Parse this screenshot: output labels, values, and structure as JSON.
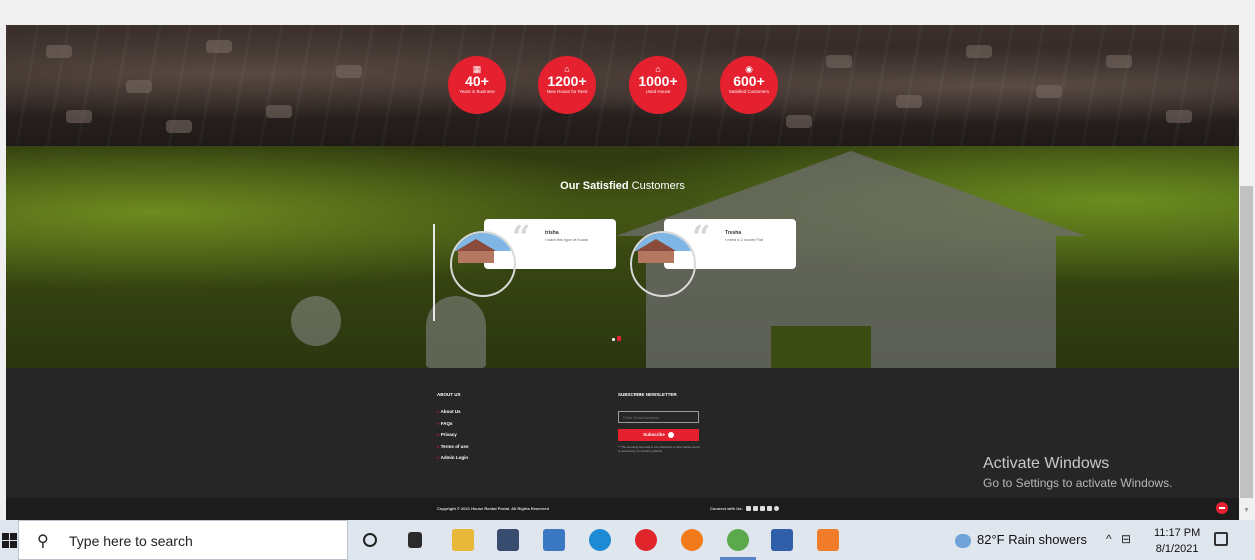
{
  "stats": [
    {
      "number": "40+",
      "label": "Years in Business",
      "icon": "calendar-icon"
    },
    {
      "number": "1200+",
      "label": "New House for Rent",
      "icon": "home-icon"
    },
    {
      "number": "1000+",
      "label": "Used House",
      "icon": "home-icon"
    },
    {
      "number": "600+",
      "label": "Satisfied Customers",
      "icon": "user-circle-icon"
    }
  ],
  "testimonials": {
    "title_bold": "Our Satisfied",
    "title_rest": "Customers",
    "items": [
      {
        "name": "trisha",
        "text": "I want this type of house"
      },
      {
        "name": "Tresha",
        "text": "I need a 2 rooom Flat"
      }
    ]
  },
  "footer": {
    "about_title": "ABOUT US",
    "links": [
      "About Us",
      "FAQs",
      "Privacy",
      "Terms of use",
      "Admin Login"
    ],
    "newsletter_title": "SUBSCRIBE NEWSLETTER",
    "email_placeholder": "Enter Email Address",
    "subscribe_label": "Subscribe",
    "note": "** The Housing site data is not published to third parties and it is secured by our privacy policies.",
    "copyright": "Copyright © 2021 House Rental Portal. All Rights Reserved",
    "connect_label": "Connect with Us:"
  },
  "watermark": {
    "line1": "Activate Windows",
    "line2": "Go to Settings to activate Windows."
  },
  "taskbar": {
    "search_placeholder": "Type here to search",
    "weather": "82°F  Rain showers",
    "time": "11:17 PM",
    "date": "8/1/2021"
  },
  "colors": {
    "accent": "#e5202f",
    "footer_bg": "#262626"
  }
}
